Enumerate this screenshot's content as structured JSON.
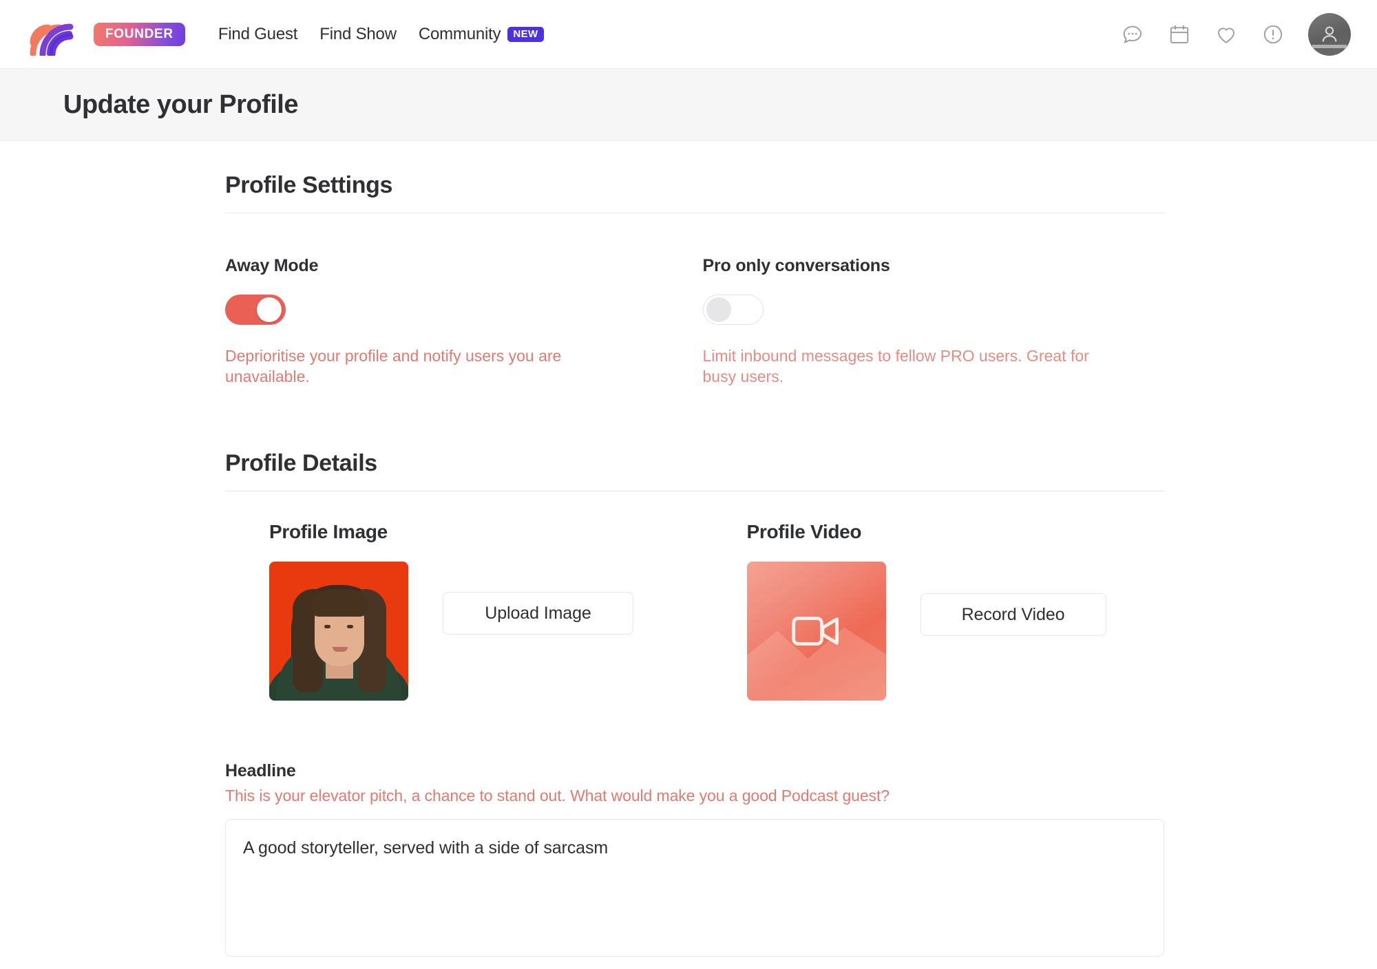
{
  "header": {
    "brand_badge": "FOUNDER",
    "logo_icon": "podcast-waves-logo",
    "nav": [
      {
        "label": "Find Guest",
        "badge": null,
        "name": "nav-find-guest"
      },
      {
        "label": "Find Show",
        "badge": null,
        "name": "nav-find-show"
      },
      {
        "label": "Community",
        "badge": "NEW",
        "name": "nav-community"
      }
    ],
    "icons": [
      {
        "name": "messages-icon"
      },
      {
        "name": "calendar-icon"
      },
      {
        "name": "favorites-heart-icon"
      },
      {
        "name": "alerts-exclamation-icon"
      }
    ],
    "avatar_icon": "user-avatar"
  },
  "page": {
    "title": "Update your Profile"
  },
  "profile_settings": {
    "heading": "Profile Settings",
    "away_mode": {
      "label": "Away Mode",
      "state": "on",
      "help": "Deprioritise your profile and notify users you are unavailable."
    },
    "pro_only": {
      "label": "Pro only conversations",
      "state": "off",
      "help": "Limit inbound messages to fellow PRO users. Great for busy users."
    }
  },
  "profile_details": {
    "heading": "Profile Details",
    "profile_image": {
      "label": "Profile Image",
      "button": "Upload Image",
      "thumb_alt": "woman-in-green-sweater-on-orange-background"
    },
    "profile_video": {
      "label": "Profile Video",
      "button": "Record Video",
      "placeholder_icon": "video-camera-icon"
    },
    "headline": {
      "label": "Headline",
      "hint": "This is your elevator pitch, a chance to stand out. What would make you a good Podcast guest?",
      "value": "A good storyteller, served with a side of sarcasm",
      "placeholder": "Headline"
    }
  },
  "colors": {
    "accent_coral": "#ea6055",
    "accent_purple": "#4c30e3",
    "help_text": "#e07a72",
    "text_dark": "#2f3033",
    "border": "#e6e6e8",
    "band_bg": "#f6f6f7"
  }
}
